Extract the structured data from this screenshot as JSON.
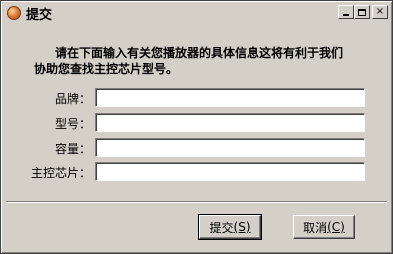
{
  "window": {
    "title": "提交",
    "icon": "app-orb-icon",
    "minimize_glyph": "_",
    "maximize_glyph": "□",
    "close_glyph": "×"
  },
  "message": {
    "line1": "请在下面输入有关您播放器的具体信息这将有利于我们",
    "line2": "协助您查找主控芯片型号。"
  },
  "fields": [
    {
      "label": "品牌：",
      "value": ""
    },
    {
      "label": "型号：",
      "value": ""
    },
    {
      "label": "容量：",
      "value": ""
    },
    {
      "label": "主控芯片：",
      "value": ""
    }
  ],
  "buttons": {
    "submit": {
      "text": "提交",
      "accel": "(S)"
    },
    "cancel": {
      "text": "取消",
      "accel": "(C)"
    }
  }
}
